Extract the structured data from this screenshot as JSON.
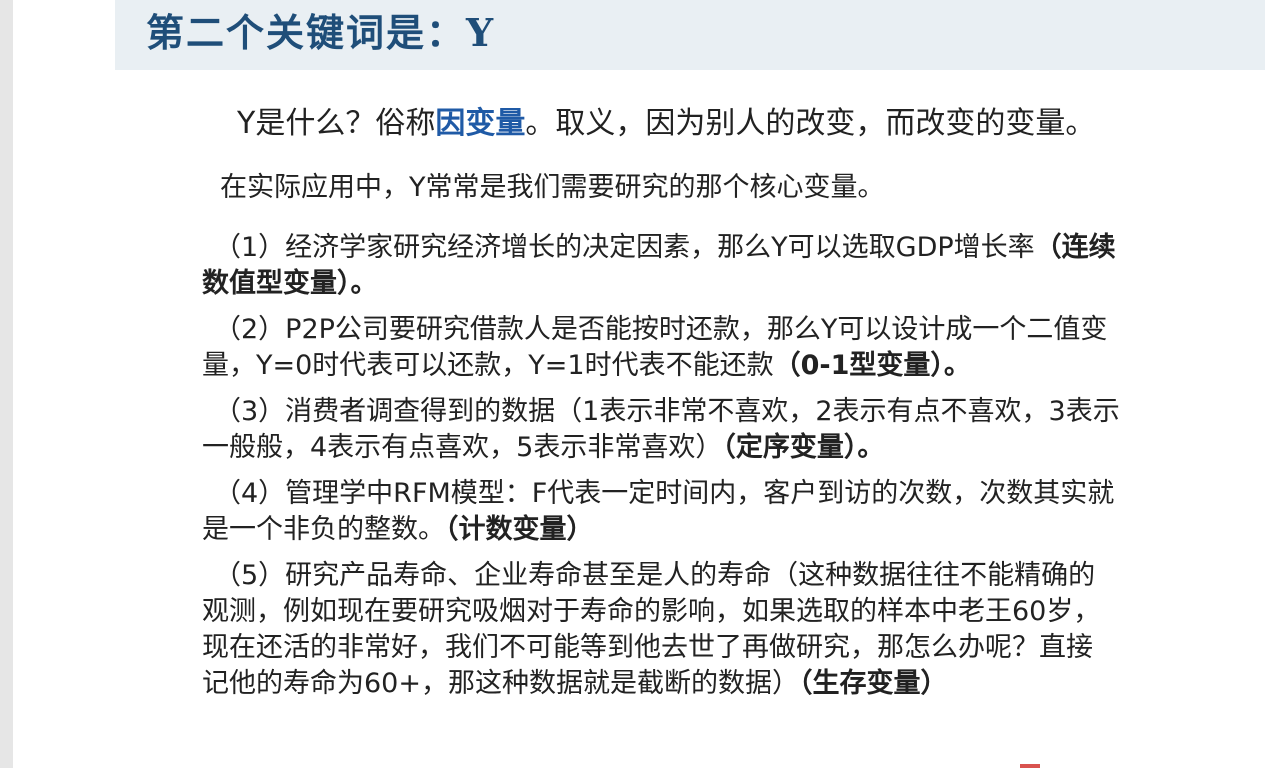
{
  "title": "第二个关键词是：Y",
  "intro": {
    "before": "Y是什么？俗称",
    "highlight": "因变量",
    "after": "。取义，因为别人的改变，而改变的变量。"
  },
  "context": "在实际应用中，Y常常是我们需要研究的那个核心变量。",
  "items": [
    {
      "line1": "（1）经济学家研究经济增长的决定因素，那么Y可以选取GDP增长率",
      "line1_bold": "（连续",
      "line2_bold": "数值型变量）。"
    },
    {
      "line1": "（2）P2P公司要研究借款人是否能按时还款，那么Y可以设计成一个二值变",
      "line2": "量，Y=0时代表可以还款，Y=1时代表不能还款",
      "line2_bold": "（0-1型变量）。"
    },
    {
      "line1": "（3）消费者调查得到的数据（1表示非常不喜欢，2表示有点不喜欢，3表示",
      "line2": "一般般，4表示有点喜欢，5表示非常喜欢）",
      "line2_bold": "（定序变量）。"
    },
    {
      "line1": "（4）管理学中RFM模型：F代表一定时间内，客户到访的次数，次数其实就",
      "line2": "是一个非负的整数。",
      "line2_bold": "（计数变量）"
    },
    {
      "line1": "（5）研究产品寿命、企业寿命甚至是人的寿命（这种数据往往不能精确的",
      "line2": "观测，例如现在要研究吸烟对于寿命的影响，如果选取的样本中老王60岁，",
      "line3": "现在还活的非常好，我们不可能等到他去世了再做研究，那怎么办呢？直接",
      "line4": "记他的寿命为60+，那这种数据就是截断的数据）",
      "line4_bold": "（生存变量）"
    }
  ],
  "colors": {
    "title": "#1f4e79",
    "highlight": "#1f5aa6",
    "title_band": "#e9eff3"
  }
}
